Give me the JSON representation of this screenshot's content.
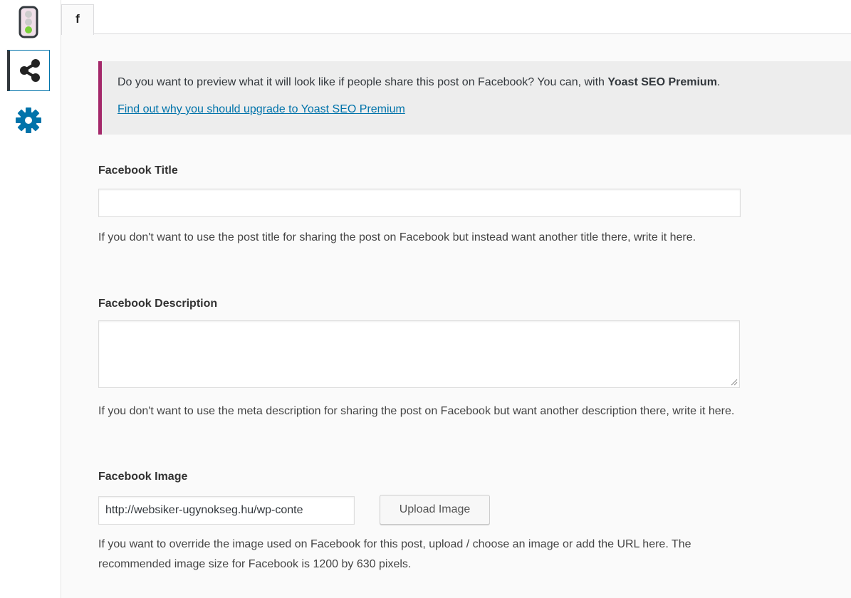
{
  "sidebar": {
    "items": [
      {
        "icon": "traffic-light-icon",
        "active": false
      },
      {
        "icon": "share-icon",
        "active": true
      },
      {
        "icon": "gear-icon",
        "active": false
      }
    ]
  },
  "tabs": [
    {
      "label": "f",
      "active": true
    }
  ],
  "notice": {
    "text": "Do you want to preview what it will look like if people share this post on Facebook? You can, with ",
    "strong": "Yoast SEO Premium",
    "text_end": ".",
    "link": "Find out why you should upgrade to Yoast SEO Premium"
  },
  "facebook_title": {
    "label": "Facebook Title",
    "value": "",
    "help": "If you don't want to use the post title for sharing the post on Facebook but instead want another title there, write it here."
  },
  "facebook_description": {
    "label": "Facebook Description",
    "value": "",
    "help": "If you don't want to use the meta description for sharing the post on Facebook but want another description there, write it here."
  },
  "facebook_image": {
    "label": "Facebook Image",
    "value": "http://websiker-ugynokseg.hu/wp-conte",
    "button": "Upload Image",
    "help": "If you want to override the image used on Facebook for this post, upload / choose an image or add the URL here. The recommended image size for Facebook is 1200 by 630 pixels."
  },
  "colors": {
    "accent": "#a4286a",
    "link": "#0073aa",
    "traffic_green": "#7ad03a"
  }
}
